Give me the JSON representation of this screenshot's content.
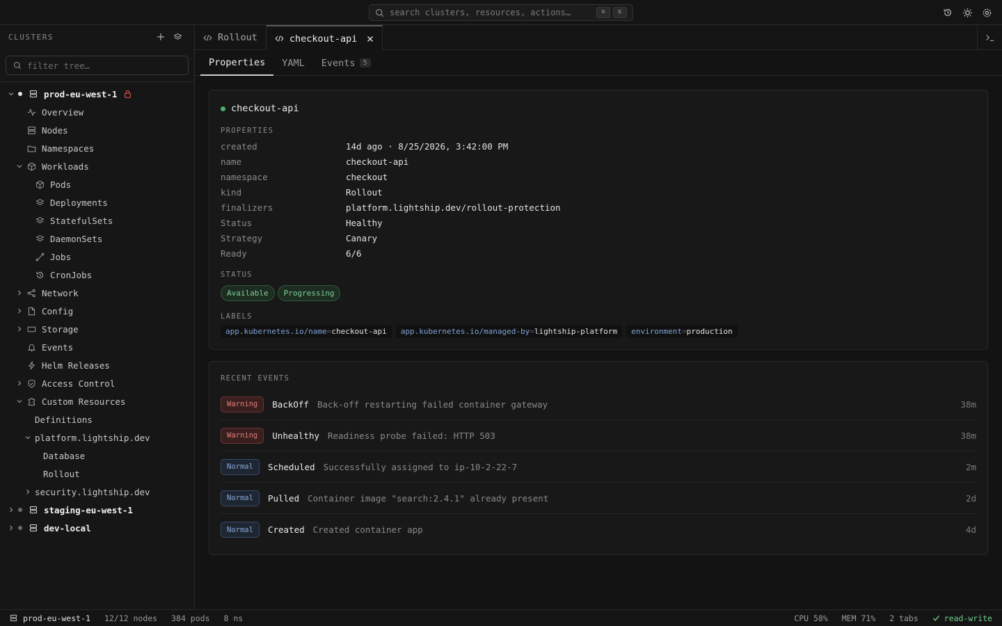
{
  "search": {
    "placeholder": "search clusters, resources, actions…",
    "kbd1": "⌘",
    "kbd2": "K"
  },
  "topbar": {
    "icons": [
      "history-icon",
      "sun-icon",
      "settings-icon"
    ]
  },
  "sidebar": {
    "title": "CLUSTERS",
    "filter_placeholder": "filter tree…",
    "tree": [
      {
        "label": "prod-eu-west-1",
        "depth": 0,
        "type": "cluster",
        "expanded": true,
        "status": "#e8e8e8",
        "locked": true
      },
      {
        "label": "Overview",
        "depth": 1,
        "icon": "activity"
      },
      {
        "label": "Nodes",
        "depth": 1,
        "icon": "server"
      },
      {
        "label": "Namespaces",
        "depth": 1,
        "icon": "folder"
      },
      {
        "label": "Workloads",
        "depth": 1,
        "icon": "box",
        "expanded": true
      },
      {
        "label": "Pods",
        "depth": 2,
        "icon": "box"
      },
      {
        "label": "Deployments",
        "depth": 2,
        "icon": "layers"
      },
      {
        "label": "StatefulSets",
        "depth": 2,
        "icon": "layers"
      },
      {
        "label": "DaemonSets",
        "depth": 2,
        "icon": "layers"
      },
      {
        "label": "Jobs",
        "depth": 2,
        "icon": "route"
      },
      {
        "label": "CronJobs",
        "depth": 2,
        "icon": "history"
      },
      {
        "label": "Network",
        "depth": 1,
        "icon": "network",
        "expanded": false
      },
      {
        "label": "Config",
        "depth": 1,
        "icon": "file",
        "expanded": false
      },
      {
        "label": "Storage",
        "depth": 1,
        "icon": "storage",
        "expanded": false
      },
      {
        "label": "Events",
        "depth": 1,
        "icon": "bell"
      },
      {
        "label": "Helm Releases",
        "depth": 1,
        "icon": "bolt"
      },
      {
        "label": "Access Control",
        "depth": 1,
        "icon": "shield",
        "expanded": false
      },
      {
        "label": "Custom Resources",
        "depth": 1,
        "icon": "puzzle",
        "expanded": true
      },
      {
        "label": "Definitions",
        "depth": 2
      },
      {
        "label": "platform.lightship.dev",
        "depth": 2,
        "expanded": true
      },
      {
        "label": "Database",
        "depth": 3
      },
      {
        "label": "Rollout",
        "depth": 3
      },
      {
        "label": "security.lightship.dev",
        "depth": 2,
        "expanded": false
      },
      {
        "label": "staging-eu-west-1",
        "depth": 0,
        "type": "cluster",
        "expanded": false,
        "status": "#6a6a6a"
      },
      {
        "label": "dev-local",
        "depth": 0,
        "type": "cluster",
        "expanded": false,
        "status": "#6a6a6a"
      }
    ]
  },
  "tabs": [
    {
      "label": "Rollout",
      "active": false
    },
    {
      "label": "checkout-api",
      "active": true
    }
  ],
  "subtabs": {
    "properties": "Properties",
    "yaml": "YAML",
    "events": "Events",
    "events_count": "5"
  },
  "resource": {
    "title": "checkout-api",
    "properties_heading": "PROPERTIES",
    "properties": [
      {
        "key": "created",
        "value": "14d ago · 8/25/2026, 3:42:00 PM"
      },
      {
        "key": "name",
        "value": "checkout-api"
      },
      {
        "key": "namespace",
        "value": "checkout"
      },
      {
        "key": "kind",
        "value": "Rollout"
      },
      {
        "key": "finalizers",
        "value": "platform.lightship.dev/rollout-protection"
      },
      {
        "key": "Status",
        "value": "Healthy"
      },
      {
        "key": "Strategy",
        "value": "Canary"
      },
      {
        "key": "Ready",
        "value": "6/6"
      }
    ],
    "status_heading": "STATUS",
    "status_chips": [
      "Available",
      "Progressing"
    ],
    "labels_heading": "LABELS",
    "labels": [
      {
        "key": "app.kubernetes.io/name",
        "value": "checkout-api"
      },
      {
        "key": "app.kubernetes.io/managed-by",
        "value": "lightship-platform"
      },
      {
        "key": "environment",
        "value": "production"
      }
    ]
  },
  "events": {
    "heading": "RECENT EVENTS",
    "items": [
      {
        "type": "Warning",
        "reason": "BackOff",
        "message": "Back-off restarting failed container gateway",
        "age": "38m"
      },
      {
        "type": "Warning",
        "reason": "Unhealthy",
        "message": "Readiness probe failed: HTTP 503",
        "age": "38m"
      },
      {
        "type": "Normal",
        "reason": "Scheduled",
        "message": "Successfully assigned to ip-10-2-22-7",
        "age": "2m"
      },
      {
        "type": "Normal",
        "reason": "Pulled",
        "message": "Container image \"search:2.4.1\" already present",
        "age": "2d"
      },
      {
        "type": "Normal",
        "reason": "Created",
        "message": "Created container app",
        "age": "4d"
      }
    ]
  },
  "statusbar": {
    "cluster": "prod-eu-west-1",
    "nodes": "12/12 nodes",
    "pods": "384 pods",
    "ns": "8 ns",
    "cpu": "CPU 58%",
    "mem": "MEM 71%",
    "tabs": "2 tabs",
    "mode": "read-write"
  }
}
